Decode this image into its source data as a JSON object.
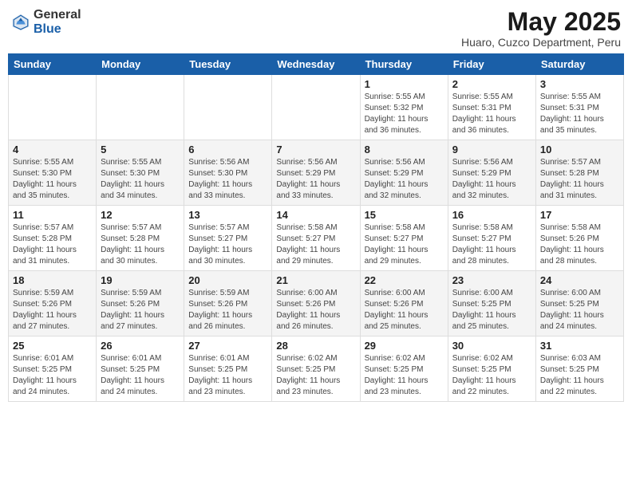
{
  "header": {
    "logo": {
      "general": "General",
      "blue": "Blue"
    },
    "title": "May 2025",
    "location": "Huaro, Cuzco Department, Peru"
  },
  "days_of_week": [
    "Sunday",
    "Monday",
    "Tuesday",
    "Wednesday",
    "Thursday",
    "Friday",
    "Saturday"
  ],
  "weeks": [
    [
      {
        "day": "",
        "info": ""
      },
      {
        "day": "",
        "info": ""
      },
      {
        "day": "",
        "info": ""
      },
      {
        "day": "",
        "info": ""
      },
      {
        "day": "1",
        "info": "Sunrise: 5:55 AM\nSunset: 5:32 PM\nDaylight: 11 hours\nand 36 minutes."
      },
      {
        "day": "2",
        "info": "Sunrise: 5:55 AM\nSunset: 5:31 PM\nDaylight: 11 hours\nand 36 minutes."
      },
      {
        "day": "3",
        "info": "Sunrise: 5:55 AM\nSunset: 5:31 PM\nDaylight: 11 hours\nand 35 minutes."
      }
    ],
    [
      {
        "day": "4",
        "info": "Sunrise: 5:55 AM\nSunset: 5:30 PM\nDaylight: 11 hours\nand 35 minutes."
      },
      {
        "day": "5",
        "info": "Sunrise: 5:55 AM\nSunset: 5:30 PM\nDaylight: 11 hours\nand 34 minutes."
      },
      {
        "day": "6",
        "info": "Sunrise: 5:56 AM\nSunset: 5:30 PM\nDaylight: 11 hours\nand 33 minutes."
      },
      {
        "day": "7",
        "info": "Sunrise: 5:56 AM\nSunset: 5:29 PM\nDaylight: 11 hours\nand 33 minutes."
      },
      {
        "day": "8",
        "info": "Sunrise: 5:56 AM\nSunset: 5:29 PM\nDaylight: 11 hours\nand 32 minutes."
      },
      {
        "day": "9",
        "info": "Sunrise: 5:56 AM\nSunset: 5:29 PM\nDaylight: 11 hours\nand 32 minutes."
      },
      {
        "day": "10",
        "info": "Sunrise: 5:57 AM\nSunset: 5:28 PM\nDaylight: 11 hours\nand 31 minutes."
      }
    ],
    [
      {
        "day": "11",
        "info": "Sunrise: 5:57 AM\nSunset: 5:28 PM\nDaylight: 11 hours\nand 31 minutes."
      },
      {
        "day": "12",
        "info": "Sunrise: 5:57 AM\nSunset: 5:28 PM\nDaylight: 11 hours\nand 30 minutes."
      },
      {
        "day": "13",
        "info": "Sunrise: 5:57 AM\nSunset: 5:27 PM\nDaylight: 11 hours\nand 30 minutes."
      },
      {
        "day": "14",
        "info": "Sunrise: 5:58 AM\nSunset: 5:27 PM\nDaylight: 11 hours\nand 29 minutes."
      },
      {
        "day": "15",
        "info": "Sunrise: 5:58 AM\nSunset: 5:27 PM\nDaylight: 11 hours\nand 29 minutes."
      },
      {
        "day": "16",
        "info": "Sunrise: 5:58 AM\nSunset: 5:27 PM\nDaylight: 11 hours\nand 28 minutes."
      },
      {
        "day": "17",
        "info": "Sunrise: 5:58 AM\nSunset: 5:26 PM\nDaylight: 11 hours\nand 28 minutes."
      }
    ],
    [
      {
        "day": "18",
        "info": "Sunrise: 5:59 AM\nSunset: 5:26 PM\nDaylight: 11 hours\nand 27 minutes."
      },
      {
        "day": "19",
        "info": "Sunrise: 5:59 AM\nSunset: 5:26 PM\nDaylight: 11 hours\nand 27 minutes."
      },
      {
        "day": "20",
        "info": "Sunrise: 5:59 AM\nSunset: 5:26 PM\nDaylight: 11 hours\nand 26 minutes."
      },
      {
        "day": "21",
        "info": "Sunrise: 6:00 AM\nSunset: 5:26 PM\nDaylight: 11 hours\nand 26 minutes."
      },
      {
        "day": "22",
        "info": "Sunrise: 6:00 AM\nSunset: 5:26 PM\nDaylight: 11 hours\nand 25 minutes."
      },
      {
        "day": "23",
        "info": "Sunrise: 6:00 AM\nSunset: 5:25 PM\nDaylight: 11 hours\nand 25 minutes."
      },
      {
        "day": "24",
        "info": "Sunrise: 6:00 AM\nSunset: 5:25 PM\nDaylight: 11 hours\nand 24 minutes."
      }
    ],
    [
      {
        "day": "25",
        "info": "Sunrise: 6:01 AM\nSunset: 5:25 PM\nDaylight: 11 hours\nand 24 minutes."
      },
      {
        "day": "26",
        "info": "Sunrise: 6:01 AM\nSunset: 5:25 PM\nDaylight: 11 hours\nand 24 minutes."
      },
      {
        "day": "27",
        "info": "Sunrise: 6:01 AM\nSunset: 5:25 PM\nDaylight: 11 hours\nand 23 minutes."
      },
      {
        "day": "28",
        "info": "Sunrise: 6:02 AM\nSunset: 5:25 PM\nDaylight: 11 hours\nand 23 minutes."
      },
      {
        "day": "29",
        "info": "Sunrise: 6:02 AM\nSunset: 5:25 PM\nDaylight: 11 hours\nand 23 minutes."
      },
      {
        "day": "30",
        "info": "Sunrise: 6:02 AM\nSunset: 5:25 PM\nDaylight: 11 hours\nand 22 minutes."
      },
      {
        "day": "31",
        "info": "Sunrise: 6:03 AM\nSunset: 5:25 PM\nDaylight: 11 hours\nand 22 minutes."
      }
    ]
  ]
}
